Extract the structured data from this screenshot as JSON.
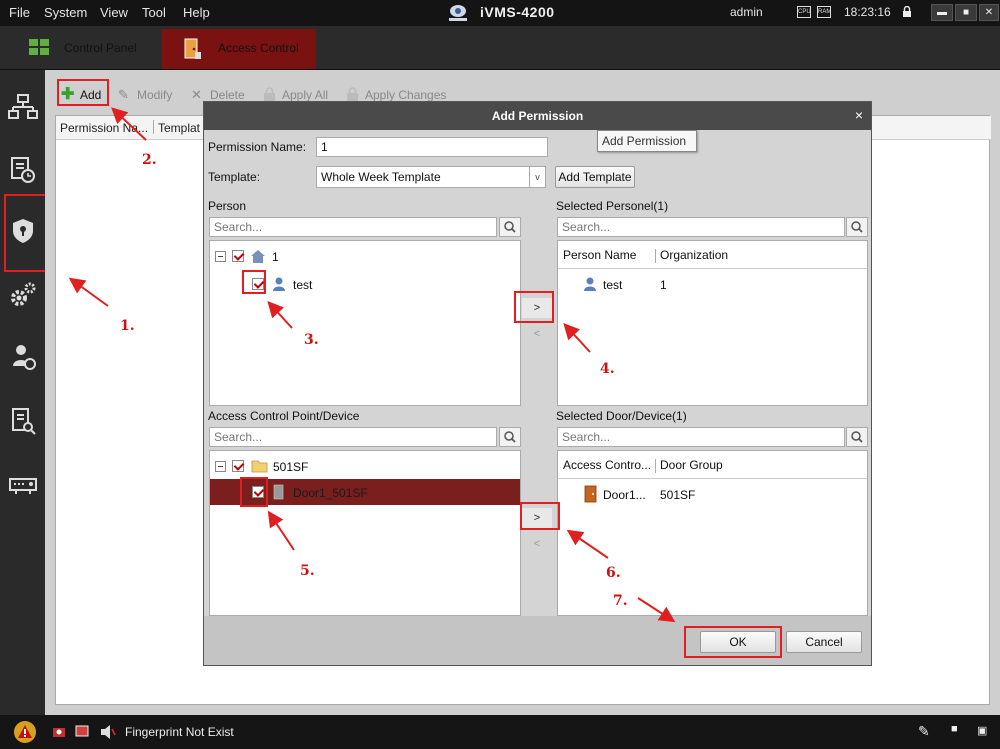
{
  "menubar": {
    "menus": [
      "File",
      "System",
      "View",
      "Tool",
      "Help"
    ],
    "app_title": "iVMS-4200",
    "user": "admin",
    "cpu_badge": "CPU",
    "ram_badge": "RAM",
    "time": "18:23:16"
  },
  "tabs": [
    {
      "label": "Control Panel"
    },
    {
      "label": "Access Control"
    }
  ],
  "toolbar": {
    "add": "Add",
    "modify": "Modify",
    "delete": "Delete",
    "apply_all": "Apply All",
    "apply_changes": "Apply Changes"
  },
  "list": {
    "col_name": "Permission Na...",
    "col_template": "Templat"
  },
  "dialog": {
    "title": "Add Permission",
    "tooltip": "Add Permission",
    "permission_name_label": "Permission Name:",
    "permission_name_value": "1",
    "template_label": "Template:",
    "template_value": "Whole Week Template",
    "add_template": "Add Template",
    "person_label": "Person",
    "search_placeholder": "Search...",
    "person_tree": {
      "group": "1",
      "member": "test"
    },
    "selected_personnel_label": "Selected Personel(1)",
    "selected_personnel_cols": [
      "Person Name",
      "Organization"
    ],
    "selected_personnel_rows": [
      {
        "name": "test",
        "org": "1"
      }
    ],
    "acp_label": "Access Control Point/Device",
    "acp_tree": {
      "group": "501SF",
      "door": "Door1_501SF"
    },
    "selected_door_label": "Selected Door/Device(1)",
    "selected_door_cols": [
      "Access Contro...",
      "Door Group"
    ],
    "selected_door_rows": [
      {
        "door": "Door1...",
        "group": "501SF"
      }
    ],
    "move_right": ">",
    "move_left": "<",
    "ok": "OK",
    "cancel": "Cancel"
  },
  "annotations": [
    "1.",
    "2.",
    "3.",
    "4.",
    "5.",
    "6.",
    "7."
  ],
  "statusbar": {
    "message": "Fingerprint Not Exist"
  },
  "colors": {
    "accent": "#7a1212",
    "annotation": "#e02020"
  }
}
